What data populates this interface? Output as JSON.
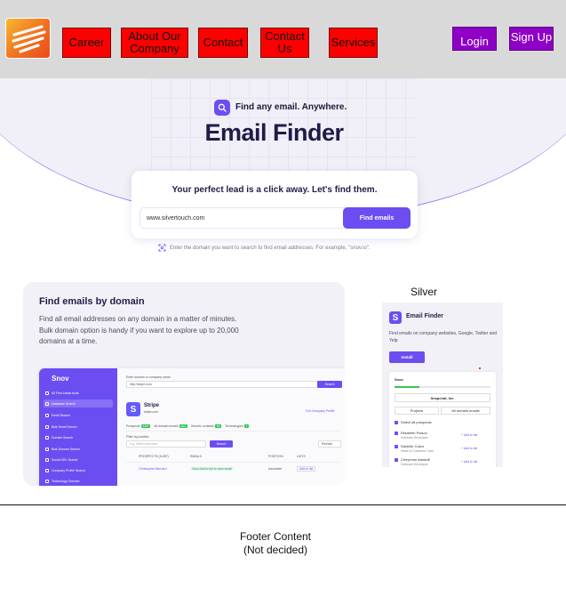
{
  "nav": {
    "items": [
      "Career",
      "About Our Company",
      "Contact",
      "Contact Us",
      "Services"
    ],
    "login": "Login",
    "signup": "Sign Up",
    "logo_icon": "brand-logo-icon"
  },
  "hero": {
    "tagline": "Find any email. Anywhere.",
    "title": "Email Finder",
    "card_title": "Your perfect lead is a click away. Let's find them.",
    "search_value": "www.silvertouch.com",
    "search_button": "Find emails",
    "hint": "Enter the domain you want to search to find email addresses. For example, \"snov.io\"."
  },
  "domain": {
    "title": "Find emails by domain",
    "description": "Find all email addresses on any domain in a matter of minutes. Bulk domain option is handy if you want to explore up to 20,000 domains at a time.",
    "app": {
      "brand": "Snov",
      "sidebar": [
        "All Find Leads tools",
        "Database Search",
        "Email Search",
        "Bulk Email Search",
        "Domain Search",
        "Bulk Domain Search",
        "Social URL Search",
        "Company Profile Search",
        "Technology Checker"
      ],
      "field_label": "Enter domain or company name",
      "field_value": "http://stripe.com",
      "search_btn": "Search",
      "company": "Stripe",
      "company_url": "stripe.com",
      "profile_link": "Full Company Profile",
      "tabs": [
        "Prospects",
        "All domain emails",
        "Generic contacts",
        "Technologies"
      ],
      "tab_counts": [
        "5487",
        "394",
        "56",
        "4"
      ],
      "filter_label": "Filter by position",
      "filter_placeholder": "e.g. Sales executive",
      "filter_btn": "Search",
      "refresh": "Refresh",
      "columns": [
        "PROSPECTS (5,487)",
        "EMAILS",
        "POSITION",
        "LISTS"
      ],
      "row_name": "Christopher Bernard",
      "row_email": "Click Add to list to view email",
      "row_position": "Associate",
      "row_list": "Add to list"
    }
  },
  "extension": {
    "label": "Silver",
    "title": "Email Finder",
    "description": "Find emails on company websites, Google, Twitter and Yelp",
    "install": "Install",
    "brand": "Snov",
    "company": "Snapchat, Inc.",
    "tabs": [
      "Projects",
      "All domain emails"
    ],
    "select_all": "Select all prospects",
    "people": [
      {
        "name": "Elisabeth Poison",
        "role": "Software Developer"
      },
      {
        "name": "Danielle Cukor",
        "role": "Head of Customer Care"
      },
      {
        "name": "Cheyenne Amstoff",
        "role": "Software Developer"
      }
    ],
    "add_to_list": "Add to list"
  },
  "footer": {
    "line1": "Footer Content",
    "line2": "(Not decided)"
  },
  "colors": {
    "nav_bg": "#d9d9d9",
    "nav_button": "#ff0000",
    "auth_button": "#8f00c7",
    "accent": "#6c4df2"
  }
}
